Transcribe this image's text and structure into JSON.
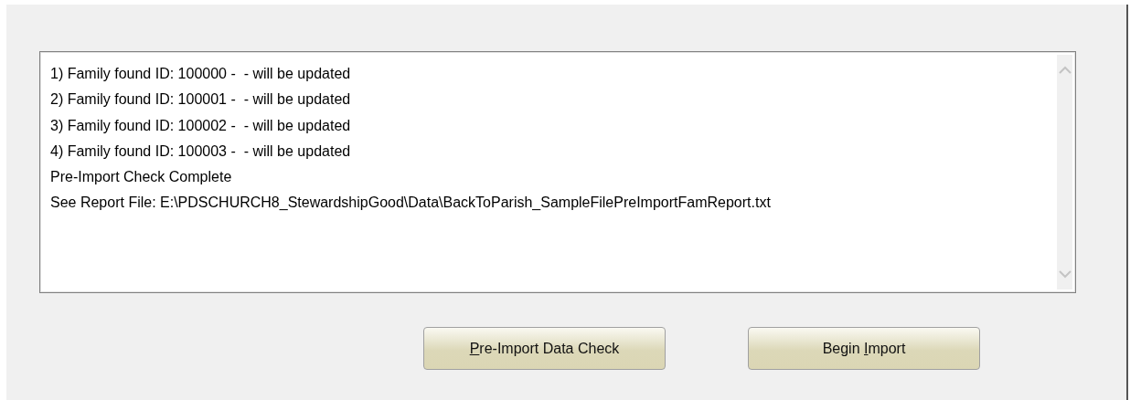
{
  "log": {
    "lines": [
      "1) Family found ID: 100000 -  - will be updated",
      "2) Family found ID: 100001 -  - will be updated",
      "3) Family found ID: 100002 -  - will be updated",
      "4) Family found ID: 100003 -  - will be updated",
      "Pre-Import Check Complete",
      "See Report File: E:\\PDSCHURCH8_StewardshipGood\\Data\\BackToParish_SampleFilePreImportFamReport.txt"
    ]
  },
  "buttons": [
    {
      "key": "P",
      "after": "re-Import Data Check"
    },
    {
      "before": "Begin ",
      "key": "I",
      "after": "mport"
    }
  ]
}
